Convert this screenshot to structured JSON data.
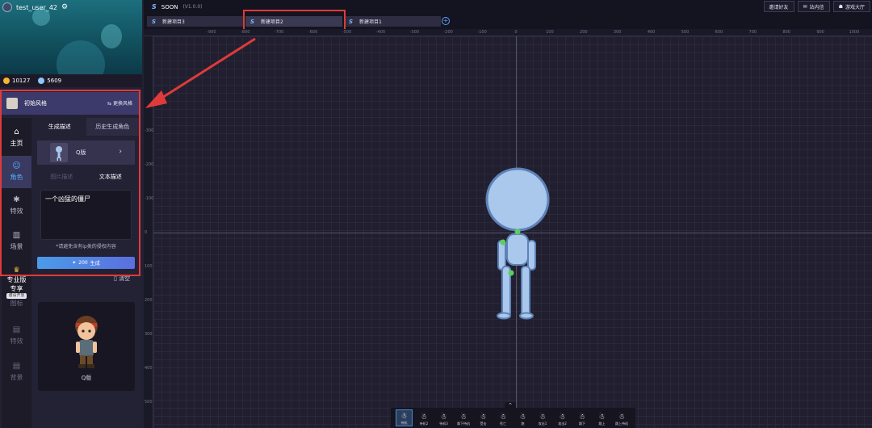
{
  "user": {
    "name": "test_user_42"
  },
  "currency": {
    "gold": "10127",
    "gems": "5609"
  },
  "style_panel": {
    "title": "初始风格",
    "change_label": "更换风格"
  },
  "nav": [
    {
      "label": "主页",
      "icon": "⌂"
    },
    {
      "label": "角色",
      "icon": "☺"
    },
    {
      "label": "特效",
      "icon": "✱"
    },
    {
      "label": "场景",
      "icon": "▥"
    }
  ],
  "pro": {
    "line1": "专业版",
    "line2": "专享",
    "badge": "邀请开放",
    "after": "图标"
  },
  "nav_dim": [
    "特效",
    "背景"
  ],
  "create": {
    "tab_generate": "生成描述",
    "tab_history": "历史生成角色",
    "style_card": "Q版",
    "tab_image": "图片描述",
    "tab_text": "文本描述",
    "prompt_text": "一个凶猛的僵尸",
    "notice": "*请避免含有ip类的侵权内容",
    "generate_cost": "200",
    "generate_label": "生成",
    "clear_label": "清空",
    "result_label": "Q版"
  },
  "app": {
    "title": "SOON",
    "version": "(V1.0.0)"
  },
  "top_buttons": [
    "邀请好友",
    "站内信",
    "游戏大厅"
  ],
  "file_tabs": [
    "新建项目3",
    "新建项目2",
    "新建项目1"
  ],
  "ruler_x": [
    "-900",
    "-800",
    "-700",
    "-600",
    "-500",
    "-400",
    "-300",
    "-200",
    "-100",
    "0",
    "100",
    "200",
    "300",
    "400",
    "500",
    "600",
    "700",
    "800",
    "900",
    "1000"
  ],
  "ruler_y": [
    "-300",
    "-200",
    "-100",
    "0",
    "100",
    "200",
    "300",
    "400",
    "500"
  ],
  "actions": [
    "待机",
    "待机2",
    "待机3",
    "属下待机",
    "受击",
    "死亡",
    "跑",
    "攻击1",
    "攻击2",
    "跳下",
    "跳上",
    "跳上待机"
  ],
  "colors": {
    "accent": "#4fb4ff",
    "highlight": "#e03a3a",
    "character": "#a9c8ec",
    "joint": "#5ad05a"
  }
}
